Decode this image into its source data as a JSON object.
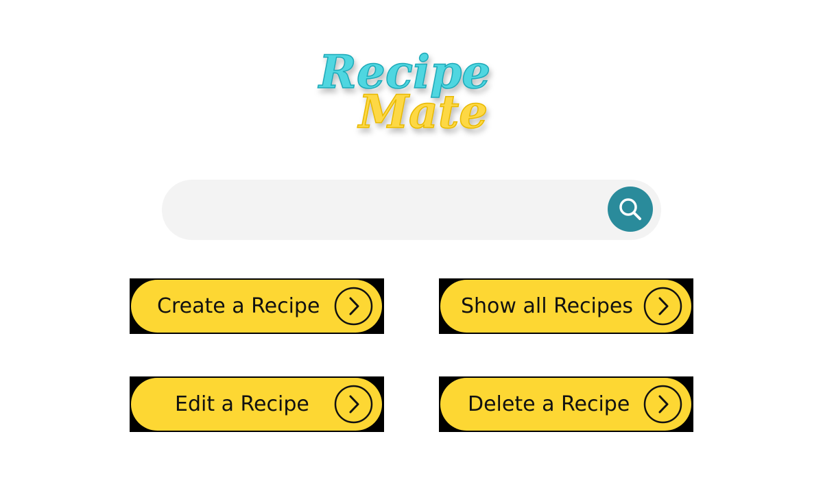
{
  "logo": {
    "line1": "Recipe",
    "line2": "Mate",
    "colors": {
      "primary": "#4fd6e0",
      "secondary": "#fdd845"
    }
  },
  "search": {
    "value": "",
    "placeholder": "",
    "icon": "search-icon",
    "button_color": "#2a8b9b"
  },
  "actions": {
    "create": {
      "label": "Create a Recipe",
      "icon": "chevron-right-icon"
    },
    "show_all": {
      "label": "Show all Recipes",
      "icon": "chevron-right-icon"
    },
    "edit": {
      "label": "Edit a Recipe",
      "icon": "chevron-right-icon"
    },
    "delete": {
      "label": "Delete a Recipe",
      "icon": "chevron-right-icon"
    }
  },
  "colors": {
    "button_fill": "#fdd733",
    "button_frame": "#000000",
    "text": "#111111"
  }
}
